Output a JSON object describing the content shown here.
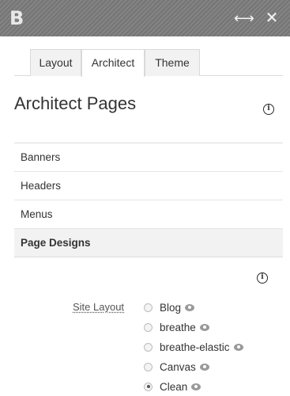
{
  "topbar": {
    "logo": "B",
    "expand_icon": "⟷",
    "close_icon": "✕"
  },
  "tabs": [
    {
      "label": "Layout"
    },
    {
      "label": "Architect"
    },
    {
      "label": "Theme"
    }
  ],
  "active_tab": "Architect",
  "page": {
    "title": "Architect Pages",
    "info_icon": "i"
  },
  "menu": {
    "items": [
      {
        "label": "Banners"
      },
      {
        "label": "Headers"
      },
      {
        "label": "Menus"
      },
      {
        "label": "Page Designs"
      }
    ],
    "active": "Page Designs"
  },
  "site_layout": {
    "label": "Site Layout",
    "options": [
      {
        "label": "Blog"
      },
      {
        "label": "breathe"
      },
      {
        "label": "breathe-elastic"
      },
      {
        "label": "Canvas"
      },
      {
        "label": "Clean"
      }
    ],
    "selected": "Clean"
  },
  "colors": {
    "topbar": "#7b7b7b",
    "active_item_bg": "#f2f2f2",
    "text": "#333333"
  }
}
